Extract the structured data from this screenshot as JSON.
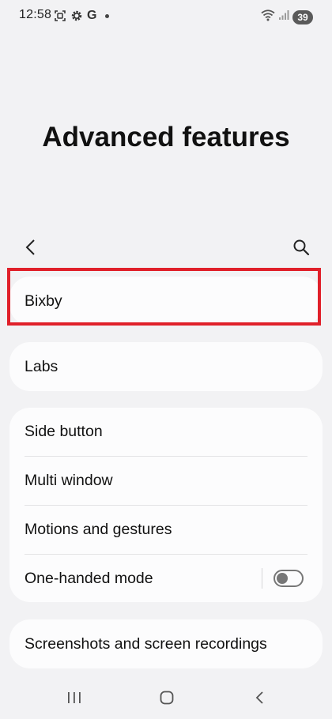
{
  "status_bar": {
    "time": "12:58",
    "left_icons": [
      "screenshot-icon",
      "settings-icon",
      "google-icon",
      "notification-dot-icon"
    ],
    "google_letter": "G",
    "right_icons": [
      "wifi-icon",
      "signal-icon",
      "battery-icon"
    ],
    "battery": "39"
  },
  "header": {
    "title": "Advanced features"
  },
  "toolbar": {
    "back_icon": "back-icon",
    "search_icon": "search-icon"
  },
  "sections": {
    "bixby": {
      "label": "Bixby"
    },
    "labs": {
      "label": "Labs"
    },
    "group": {
      "side_button": "Side button",
      "multi_window": "Multi window",
      "motions": "Motions and gestures",
      "one_handed": "One-handed mode",
      "one_handed_enabled": false
    },
    "screens": {
      "label": "Screenshots and screen recordings"
    }
  },
  "highlight_color": "#e0202a",
  "nav_bar": {
    "icons": [
      "recents-icon",
      "home-icon",
      "nav-back-icon"
    ]
  }
}
